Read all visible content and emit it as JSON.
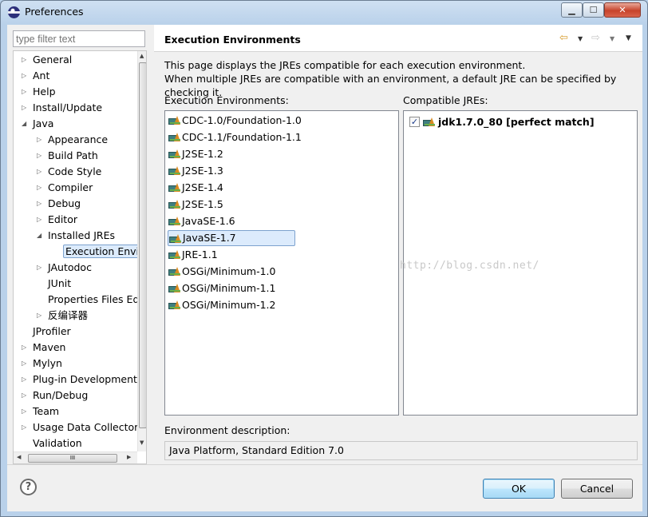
{
  "window": {
    "title": "Preferences",
    "controls": {
      "minimize": "▁",
      "maximize": "☐",
      "close": "✕"
    }
  },
  "filter": {
    "placeholder": "type filter text"
  },
  "tree": {
    "items": [
      {
        "label": "General",
        "depth": 0,
        "expander": "collapsed"
      },
      {
        "label": "Ant",
        "depth": 0,
        "expander": "collapsed"
      },
      {
        "label": "Help",
        "depth": 0,
        "expander": "collapsed"
      },
      {
        "label": "Install/Update",
        "depth": 0,
        "expander": "collapsed"
      },
      {
        "label": "Java",
        "depth": 0,
        "expander": "expanded"
      },
      {
        "label": "Appearance",
        "depth": 1,
        "expander": "collapsed"
      },
      {
        "label": "Build Path",
        "depth": 1,
        "expander": "collapsed"
      },
      {
        "label": "Code Style",
        "depth": 1,
        "expander": "collapsed"
      },
      {
        "label": "Compiler",
        "depth": 1,
        "expander": "collapsed"
      },
      {
        "label": "Debug",
        "depth": 1,
        "expander": "collapsed"
      },
      {
        "label": "Editor",
        "depth": 1,
        "expander": "collapsed"
      },
      {
        "label": "Installed JREs",
        "depth": 1,
        "expander": "expanded"
      },
      {
        "label": "Execution Envir",
        "depth": 2,
        "expander": "none",
        "selected": true
      },
      {
        "label": "JAutodoc",
        "depth": 1,
        "expander": "collapsed"
      },
      {
        "label": "JUnit",
        "depth": 1,
        "expander": "none"
      },
      {
        "label": "Properties Files Ed",
        "depth": 1,
        "expander": "none"
      },
      {
        "label": "反编译器",
        "depth": 1,
        "expander": "collapsed"
      },
      {
        "label": "JProfiler",
        "depth": 0,
        "expander": "none"
      },
      {
        "label": "Maven",
        "depth": 0,
        "expander": "collapsed"
      },
      {
        "label": "Mylyn",
        "depth": 0,
        "expander": "collapsed"
      },
      {
        "label": "Plug-in Development",
        "depth": 0,
        "expander": "collapsed"
      },
      {
        "label": "Run/Debug",
        "depth": 0,
        "expander": "collapsed"
      },
      {
        "label": "Team",
        "depth": 0,
        "expander": "collapsed"
      },
      {
        "label": "Usage Data Collector",
        "depth": 0,
        "expander": "collapsed"
      },
      {
        "label": "Validation",
        "depth": 0,
        "expander": "none"
      }
    ],
    "hscroll_grip": "III"
  },
  "page": {
    "title": "Execution Environments",
    "description_line1": "This page displays the JREs compatible for each execution environment.",
    "description_line2": "When multiple JREs are compatible with an environment, a default JRE can be specified by checking it.",
    "ee_label": "Execution Environments:",
    "cj_label": "Compatible JREs:",
    "environments": [
      "CDC-1.0/Foundation-1.0",
      "CDC-1.1/Foundation-1.1",
      "J2SE-1.2",
      "J2SE-1.3",
      "J2SE-1.4",
      "J2SE-1.5",
      "JavaSE-1.6",
      "JavaSE-1.7",
      "JRE-1.1",
      "OSGi/Minimum-1.0",
      "OSGi/Minimum-1.1",
      "OSGi/Minimum-1.2"
    ],
    "selected_environment": "JavaSE-1.7",
    "compatible_jres": [
      {
        "label": "jdk1.7.0_80 [perfect match]",
        "checked": true,
        "check_glyph": "✓"
      }
    ],
    "env_description_label": "Environment description:",
    "env_description_value": "Java Platform, Standard Edition 7.0",
    "watermark": "http://blog.csdn.net/"
  },
  "nav_icons": [
    "back-arrow-icon",
    "forward-arrow-icon",
    "view-menu-icon"
  ],
  "icons": {
    "back": "⇦",
    "forward": "⇨",
    "dropdown": "▼",
    "help": "?"
  },
  "buttons": {
    "ok": "OK",
    "cancel": "Cancel"
  },
  "colors": {
    "selection_bg": "#dcebfc",
    "selection_border": "#7da2ce",
    "ok_border": "#3c7fb1"
  }
}
